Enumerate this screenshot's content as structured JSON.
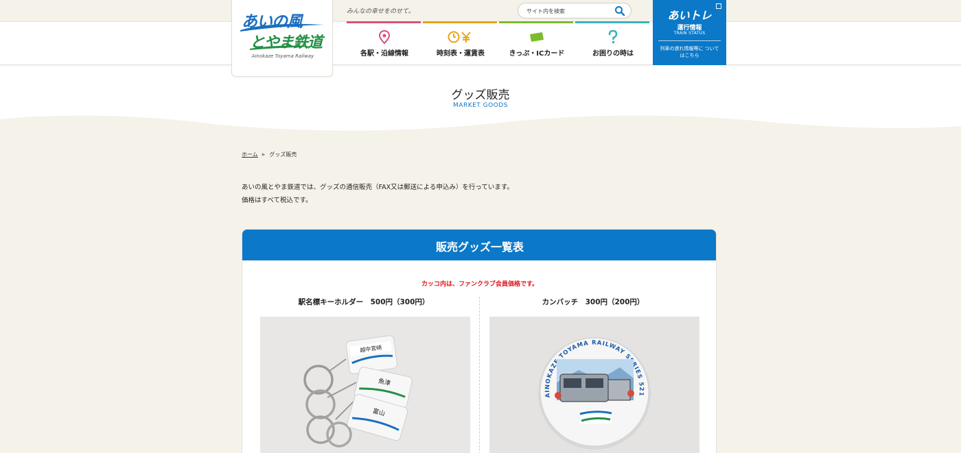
{
  "header": {
    "logo": {
      "line1": "あいの風",
      "line2": "とやま鉄道",
      "english": "Ainokaze Toyama Railway"
    },
    "tagline": "みんなの幸せをのせて。",
    "search": {
      "placeholder": "サイト内を検索"
    },
    "nav": [
      {
        "label": "各駅・沿線情報",
        "icon": "map-pin-icon",
        "color": "#d94f7b"
      },
      {
        "label": "時刻表・運賃表",
        "icon": "clock-yen-icon",
        "color": "#e8a317"
      },
      {
        "label": "きっぷ・ICカード",
        "icon": "ticket-icon",
        "color": "#7bbb2c"
      },
      {
        "label": "お困りの時は",
        "icon": "question-icon",
        "color": "#3bb2b8"
      }
    ],
    "aitore": {
      "brand": "あいトレ",
      "title": "運行情報",
      "subtitle": "TRAIN STATUS",
      "note": "列車の遅れ情報等に ついてはこちら"
    }
  },
  "hero": {
    "title": "グッズ販売",
    "subtitle": "MARKET GOODS"
  },
  "breadcrumb": {
    "home": "ホーム",
    "current": "グッズ販売"
  },
  "intro": {
    "line1": "あいの風とやま鉄道では、グッズの通信販売（FAX又は郵送による申込み）を行っています。",
    "line2": "価格はすべて税込です。"
  },
  "goods": {
    "title": "販売グッズ一覧表",
    "note": "カッコ内は、ファンクラブ会員価格です。",
    "items": [
      {
        "name": "駅名標キーホルダー　500円（300円）",
        "image": "keychain-photo"
      },
      {
        "name": "カンバッチ　300円（200円）",
        "image": "badge-photo"
      }
    ]
  },
  "photo_text": {
    "keychain": {
      "tag1": "越中宮崎",
      "tag2": "魚津",
      "tag3": "富山"
    },
    "badge_ring": "AINOKAZE TOYAMA RAILWAY SERIES 521"
  },
  "colors": {
    "accent": "#0b78c8",
    "warning": "#e0141e",
    "background": "#f5f2e9"
  }
}
